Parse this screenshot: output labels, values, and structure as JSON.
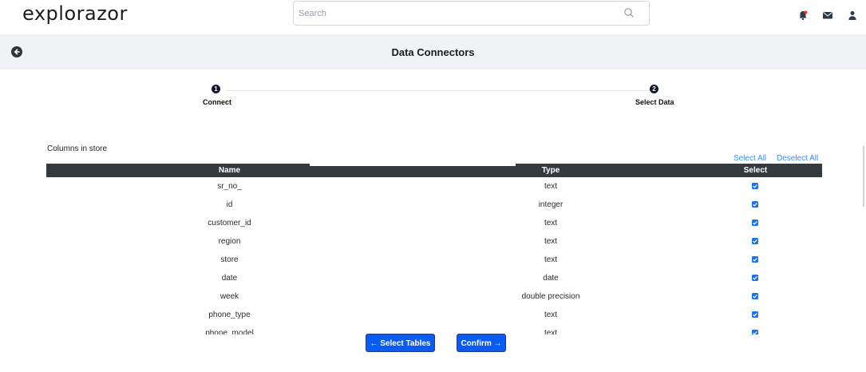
{
  "app": {
    "logo": "explorazor"
  },
  "search": {
    "placeholder": "Search"
  },
  "header_icons": [
    "notification-bell-icon",
    "mail-icon",
    "user-icon"
  ],
  "page": {
    "title": "Data Connectors"
  },
  "steps": [
    {
      "number": "1",
      "label": "Connect"
    },
    {
      "number": "2",
      "label": "Select Data"
    }
  ],
  "section": {
    "label": "Columns in store"
  },
  "actions": {
    "select_all": "Select All",
    "deselect_all": "Deselect All"
  },
  "table": {
    "headers": {
      "name": "Name",
      "type": "Type",
      "select": "Select"
    },
    "rows": [
      {
        "name": "sr_no_",
        "type": "text",
        "checked": true
      },
      {
        "name": "id",
        "type": "integer",
        "checked": true
      },
      {
        "name": "customer_id",
        "type": "text",
        "checked": true
      },
      {
        "name": "region",
        "type": "text",
        "checked": true
      },
      {
        "name": "store",
        "type": "text",
        "checked": true
      },
      {
        "name": "date",
        "type": "date",
        "checked": true
      },
      {
        "name": "week",
        "type": "double precision",
        "checked": true
      },
      {
        "name": "phone_type",
        "type": "text",
        "checked": true
      },
      {
        "name": "phone_model",
        "type": "text",
        "checked": true
      }
    ]
  },
  "buttons": {
    "back": "← Select Tables",
    "confirm": "Confirm →"
  },
  "colors": {
    "primary": "#0a5cf0",
    "header_dark": "#343a40",
    "link": "#3b8cf0",
    "checkbox": "#1a73e8"
  }
}
